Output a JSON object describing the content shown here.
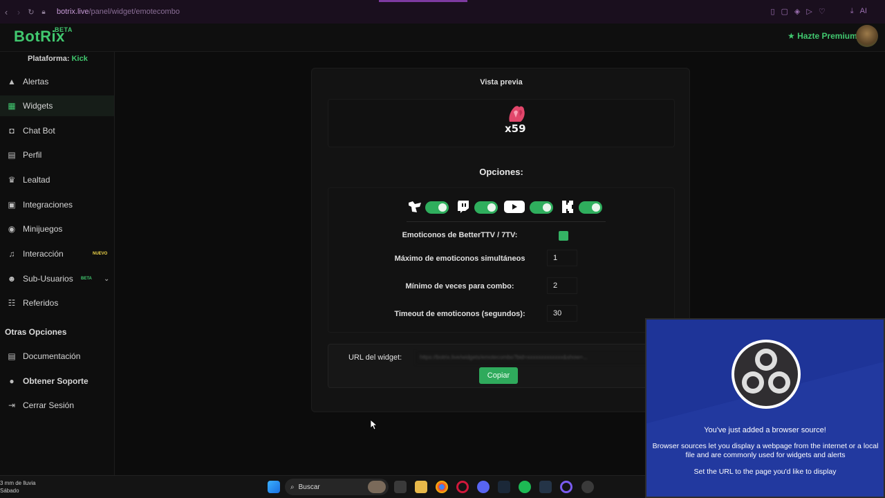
{
  "browser": {
    "url_domain": "botrix.live",
    "url_path": "/panel/widget/emotecombo"
  },
  "header": {
    "logo": "BotRix",
    "logo_badge": "BETA",
    "premium_label": "Hazte Premium"
  },
  "sidebar": {
    "platform_label": "Plataforma:",
    "platform_value": "Kick",
    "items": [
      {
        "label": "Alertas",
        "icon": "warning-icon"
      },
      {
        "label": "Widgets",
        "icon": "grid-icon"
      },
      {
        "label": "Chat Bot",
        "icon": "robot-icon"
      },
      {
        "label": "Perfil",
        "icon": "id-card-icon"
      },
      {
        "label": "Lealtad",
        "icon": "trophy-icon"
      },
      {
        "label": "Integraciones",
        "icon": "plug-icon"
      },
      {
        "label": "Minijuegos",
        "icon": "gamepad-icon"
      },
      {
        "label": "Interacción",
        "icon": "music-icon",
        "badge": "NUEVO"
      },
      {
        "label": "Sub-Usuarios",
        "icon": "users-icon",
        "badge": "BETA"
      },
      {
        "label": "Referidos",
        "icon": "people-icon"
      }
    ],
    "other_title": "Otras Opciones",
    "other_items": [
      {
        "label": "Documentación",
        "icon": "document-icon"
      },
      {
        "label": "Obtener Soporte",
        "icon": "help-icon"
      },
      {
        "label": "Cerrar Sesión",
        "icon": "logout-icon"
      }
    ]
  },
  "widget": {
    "preview_title": "Vista previa",
    "combo_text": "x59",
    "options_title": "Opciones:",
    "platforms": [
      "kick-chat-icon",
      "twitch-icon",
      "youtube-icon",
      "kick-icon"
    ],
    "bttv_label": "Emoticonos de BetterTTV / 7TV:",
    "max_label": "Máximo de emoticonos simultáneos",
    "max_value": "1",
    "min_label": "Mínimo de veces para combo:",
    "min_value": "2",
    "timeout_label": "Timeout de emoticonos (segundos):",
    "timeout_value": "30",
    "url_label": "URL del widget:",
    "url_value": "https://botrix.live/widgets/emotecombo?bid=xxxxxxxxxxxxx&show=...",
    "copy_label": "Copiar"
  },
  "obs": {
    "title": "You've just added a browser source!",
    "body": "Browser sources let you display a webpage from the internet or a local file and are commonly used for widgets and alerts",
    "hint": "Set the URL to the page you'd like to display"
  },
  "taskbar": {
    "weather_line1": "3 mm de lluvia",
    "weather_line2": "Sábado",
    "search_label": "Buscar"
  },
  "colors": {
    "accent": "#41c86f",
    "obs_blue": "#1a2e8a"
  }
}
